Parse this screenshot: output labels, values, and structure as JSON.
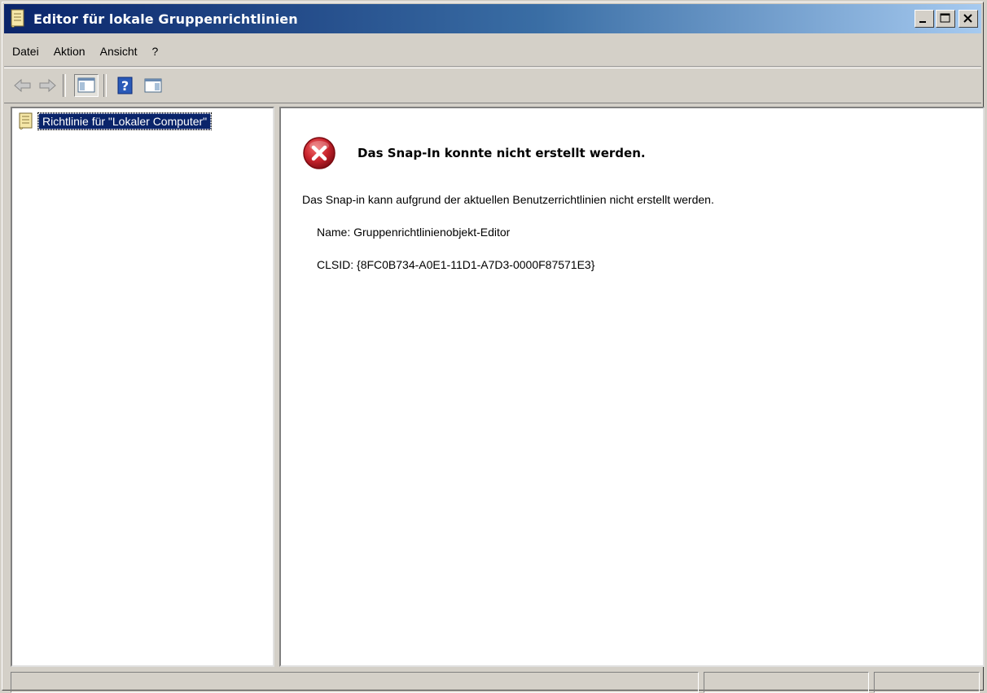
{
  "window": {
    "title": "Editor für lokale Gruppenrichtlinien",
    "controls": [
      "minimize",
      "maximize",
      "close"
    ]
  },
  "menu": {
    "items": [
      "Datei",
      "Aktion",
      "Ansicht",
      "?"
    ]
  },
  "toolbar": {
    "icons": [
      "back-arrow-icon",
      "forward-arrow-icon",
      "show-hide-console-tree-icon",
      "help-icon",
      "show-hide-action-pane-icon"
    ]
  },
  "tree": {
    "root_label": "Richtlinie für \"Lokaler Computer\""
  },
  "error": {
    "title": "Das Snap-In konnte nicht erstellt werden.",
    "message": "Das Snap-in kann aufgrund der aktuellen Benutzerrichtlinien nicht erstellt werden.",
    "name_line": "Name: Gruppenrichtlinienobjekt-Editor",
    "clsid_line": "CLSID: {8FC0B734-A0E1-11D1-A7D3-0000F87571E3}"
  },
  "colors": {
    "titlebar_start": "#0a246a",
    "titlebar_end": "#a6caf0",
    "selection": "#0a246a",
    "error_red": "#c8232c",
    "chrome": "#d4d0c8"
  }
}
